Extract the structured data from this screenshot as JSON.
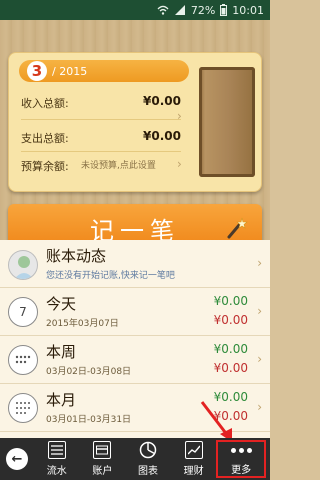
{
  "status_bar": {
    "battery": "72%",
    "time": "10:01"
  },
  "summary": {
    "month": "3",
    "year": "/ 2015",
    "income_label": "收入总额:",
    "income_value": "¥0.00",
    "expense_label": "支出总额:",
    "expense_value": "¥0.00",
    "budget_label": "预算余额:",
    "budget_hint": "未设预算,点此设置"
  },
  "record_button": {
    "label": "记一笔"
  },
  "list": {
    "items": [
      {
        "title": "账本动态",
        "subtitle": "您还没有开始记账,快来记一笔吧",
        "income": "",
        "expense": ""
      },
      {
        "title": "今天",
        "subtitle": "2015年03月07日",
        "icon_text": "7",
        "income": "¥0.00",
        "expense": "¥0.00"
      },
      {
        "title": "本周",
        "subtitle": "03月02日-03月08日",
        "income": "¥0.00",
        "expense": "¥0.00"
      },
      {
        "title": "本月",
        "subtitle": "03月01日-03月31日",
        "income": "¥0.00",
        "expense": "¥0.00"
      }
    ]
  },
  "bottom_nav": {
    "items": [
      {
        "label": "流水",
        "icon": "list-icon"
      },
      {
        "label": "账户",
        "icon": "card-icon"
      },
      {
        "label": "图表",
        "icon": "pie-chart-icon"
      },
      {
        "label": "理财",
        "icon": "trend-icon"
      },
      {
        "label": "更多",
        "icon": "more-icon"
      }
    ]
  },
  "colors": {
    "status_bar": "#1e4f33",
    "accent_orange": "#ef8416",
    "income_green": "#2e8b3a",
    "expense_red": "#c03030",
    "highlight_red": "#e32222"
  }
}
